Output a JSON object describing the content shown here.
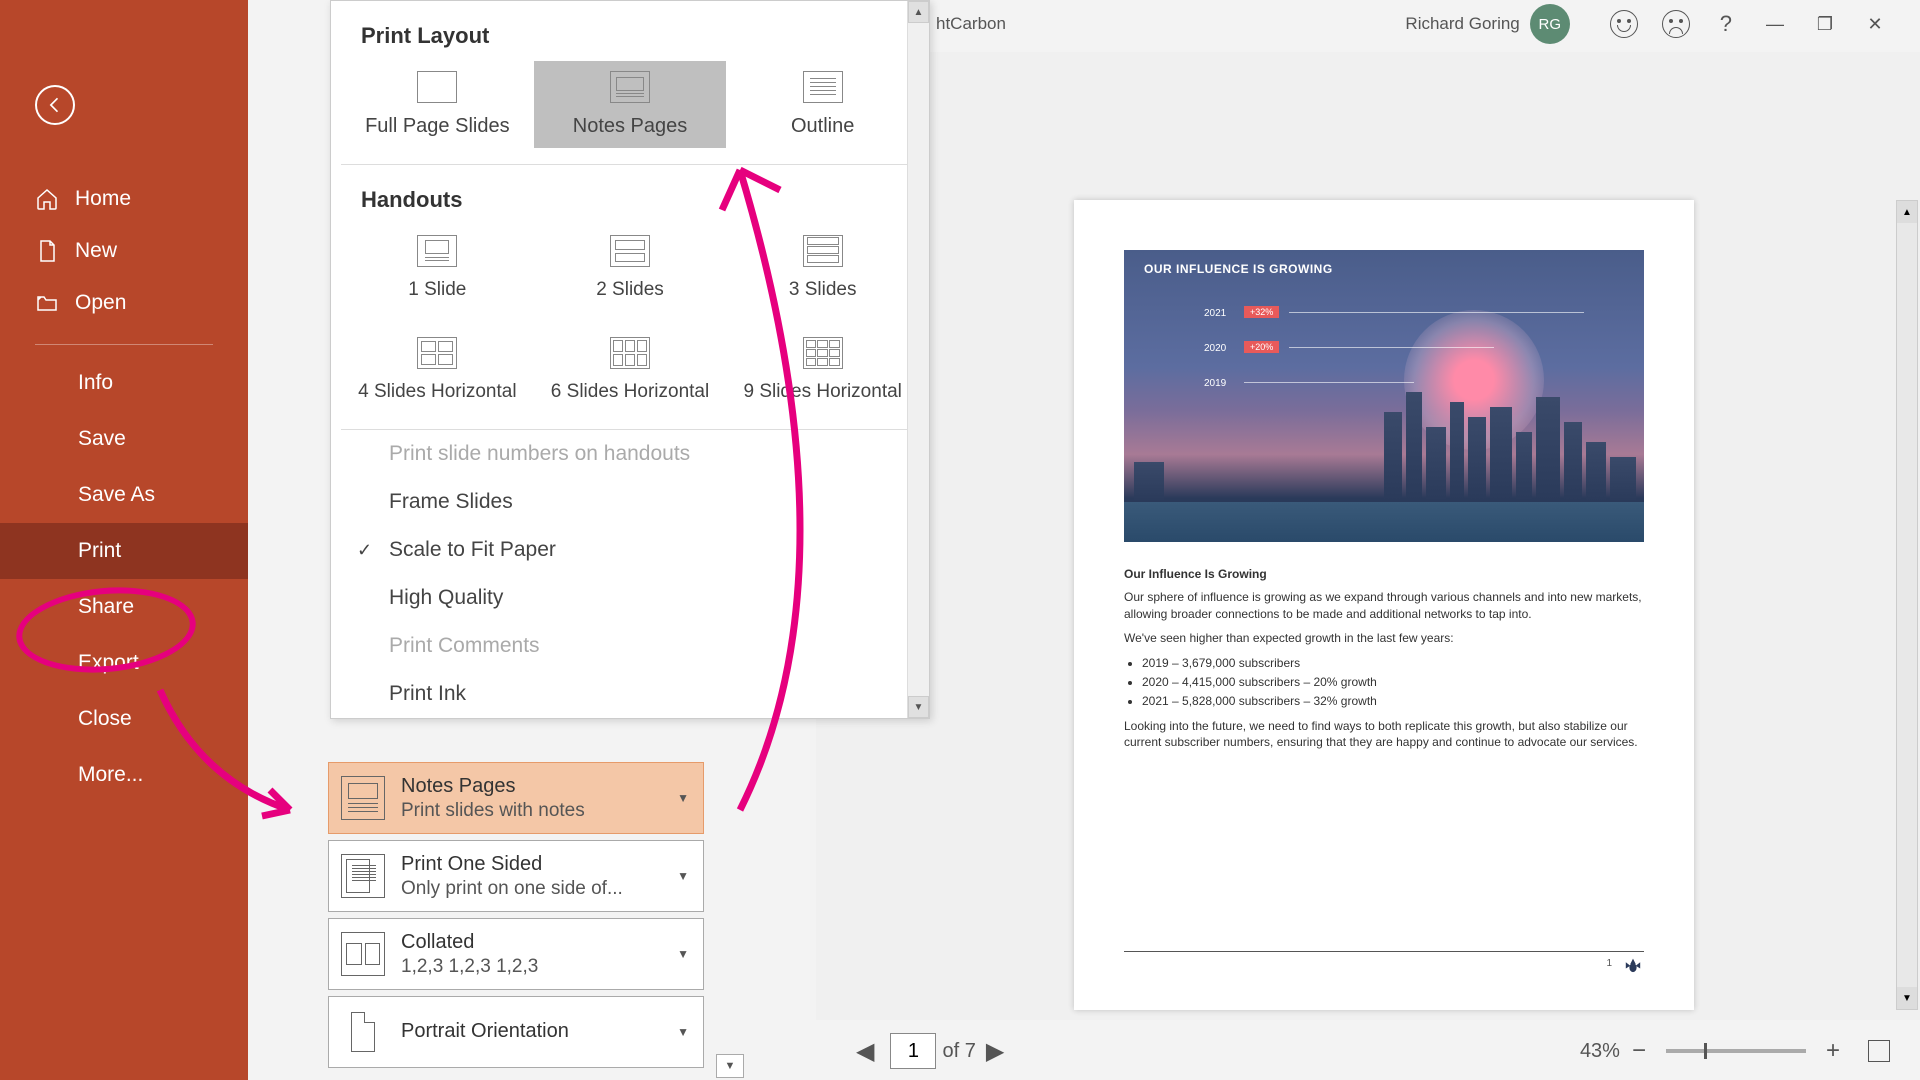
{
  "titlebar": {
    "doc_fragment": "htCarbon",
    "username": "Richard Goring",
    "initials": "RG"
  },
  "sidebar": {
    "home": "Home",
    "new": "New",
    "open": "Open",
    "info": "Info",
    "save": "Save",
    "save_as": "Save As",
    "print": "Print",
    "share": "Share",
    "export": "Export",
    "close": "Close",
    "more": "More..."
  },
  "dropdown": {
    "section_layout": "Print Layout",
    "full_page": "Full Page Slides",
    "notes_pages": "Notes Pages",
    "outline": "Outline",
    "section_handouts": "Handouts",
    "h1": "1 Slide",
    "h2": "2 Slides",
    "h3": "3 Slides",
    "h4": "4 Slides Horizontal",
    "h6": "6 Slides Horizontal",
    "h9": "9 Slides Horizontal",
    "opt_slide_numbers": "Print slide numbers on handouts",
    "opt_frame": "Frame Slides",
    "opt_scale": "Scale to Fit Paper",
    "opt_hq": "High Quality",
    "opt_comments": "Print Comments",
    "opt_ink": "Print Ink"
  },
  "settings": {
    "layout": {
      "title": "Notes Pages",
      "sub": "Print slides with notes"
    },
    "sided": {
      "title": "Print One Sided",
      "sub": "Only print on one side of..."
    },
    "collated": {
      "title": "Collated",
      "sub": "1,2,3     1,2,3     1,2,3"
    },
    "orientation": {
      "title": "Portrait Orientation"
    }
  },
  "preview": {
    "slide_title": "OUR INFLUENCE IS GROWING",
    "years": [
      {
        "year": "2021",
        "badge": "+32%"
      },
      {
        "year": "2020",
        "badge": "+20%"
      },
      {
        "year": "2019",
        "badge": ""
      }
    ],
    "notes": {
      "title": "Our Influence Is Growing",
      "p1": "Our sphere of influence is growing as we expand through various channels and into new markets, allowing broader connections to be made and additional networks to tap into.",
      "p2": "We've seen higher than expected growth in the last few years:",
      "bullets": [
        "2019 – 3,679,000 subscribers",
        "2020 – 4,415,000 subscribers – 20% growth",
        "2021 – 5,828,000 subscribers – 32% growth"
      ],
      "p3": "Looking into the future, we need to find ways to both replicate this growth, but also stabilize our current subscriber numbers, ensuring that they are happy and continue to advocate our services."
    },
    "page_number": "1"
  },
  "bottombar": {
    "current_page": "1",
    "total": " of 7",
    "zoom": "43%"
  }
}
